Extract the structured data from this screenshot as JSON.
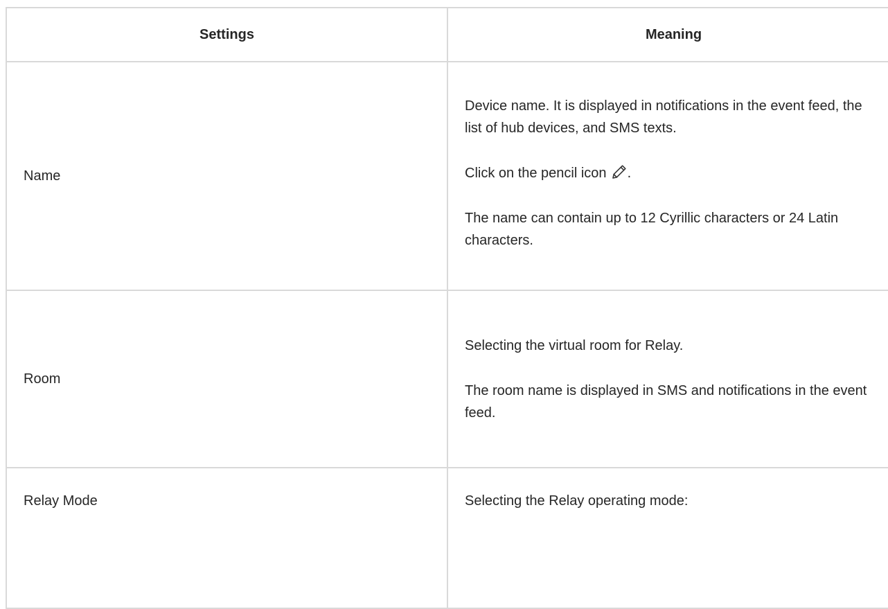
{
  "table": {
    "headers": {
      "settings": "Settings",
      "meaning": "Meaning"
    },
    "rows": [
      {
        "setting": "Name",
        "meaning": [
          "Device name. It is displayed in notifications in the event feed, the list of hub devices, and SMS texts.",
          "Click on the pencil icon",
          "The name can contain up to 12 Cyrillic characters or 24 Latin characters."
        ],
        "pencil_suffix": ".",
        "pencil_icon": "pencil-icon"
      },
      {
        "setting": "Room",
        "meaning": [
          "Selecting the virtual room for Relay.",
          "The room name is displayed in SMS and notifications in the event feed."
        ]
      },
      {
        "setting": "Relay Mode",
        "meaning": [
          "Selecting the Relay operating mode:"
        ]
      }
    ]
  }
}
